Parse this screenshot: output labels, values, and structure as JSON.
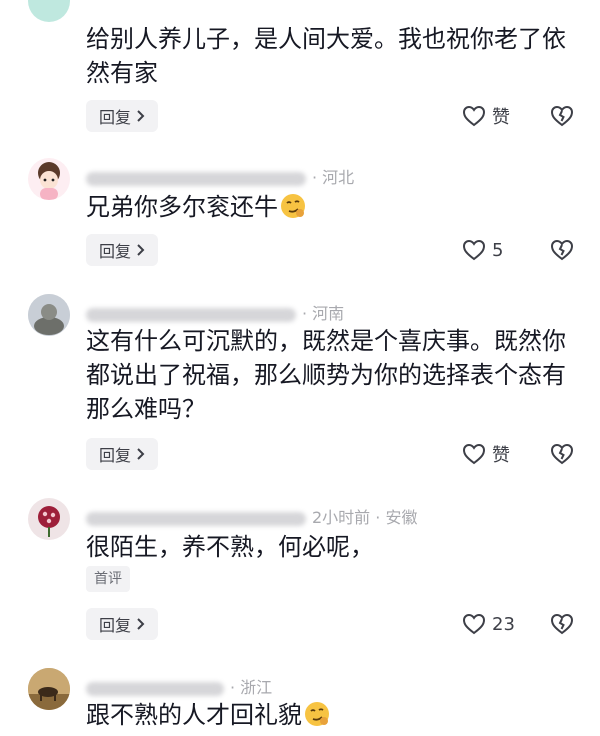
{
  "comments": [
    {
      "location": "",
      "text": "给别人养儿子，是人间大爱。我也祝你老了依然有家",
      "reply_label": "回复",
      "like_label": "赞"
    },
    {
      "location": "· 河北",
      "text": "兄弟你多尔衮还牛",
      "reply_label": "回复",
      "like_label": "5"
    },
    {
      "location": "· 河南",
      "text": "这有什么可沉默的，既然是个喜庆事。既然你都说出了祝福，那么顺势为你的选择表个态有那么难吗？",
      "reply_label": "回复",
      "like_label": "赞"
    },
    {
      "time": "2小时前",
      "location": "· 安徽",
      "text": "很陌生，养不熟，何必呢，",
      "tag": "首评",
      "reply_label": "回复",
      "like_label": "23"
    },
    {
      "location": "· 浙江",
      "text": "跟不熟的人才回礼貌"
    }
  ],
  "icons": {
    "heart": "heart-outline-icon",
    "broken_heart": "broken-heart-icon",
    "chevron": "chevron-right-icon",
    "emoji": "smirk-emoji-icon"
  },
  "colors": {
    "text": "#161823",
    "meta": "#a8a9ae",
    "button_bg": "#f2f2f4"
  }
}
